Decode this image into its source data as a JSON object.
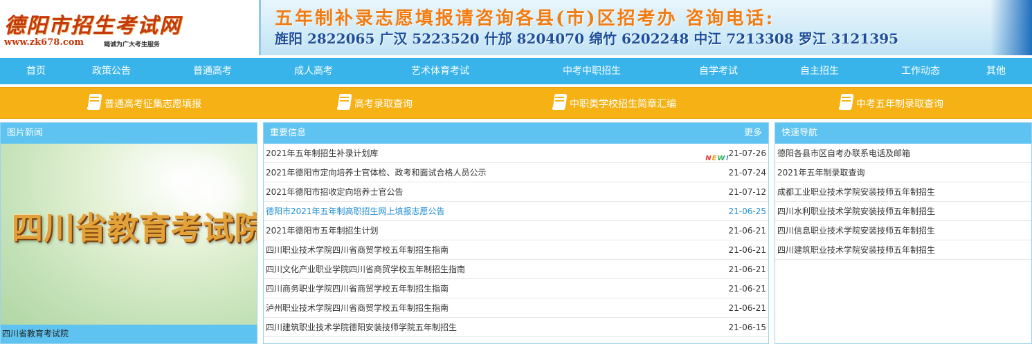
{
  "header": {
    "logo_text": "德阳市招生考试网",
    "logo_url": "www.zk678.com",
    "logo_slogan": "竭诚为广大考生服务",
    "banner_line1": "五年制补录志愿填报请咨询各县(市)区招考办 咨询电话:",
    "banner_line2": "旌阳 2822065  广汉 5223520  什邡 8204070  绵竹 6202248  中江 7213308  罗江 3121395"
  },
  "nav": {
    "items": [
      "首页",
      "政策公告",
      "普通高考",
      "成人高考",
      "艺术体育考试",
      "中考中职招生",
      "自学考试",
      "自主招生",
      "工作动态",
      "其他"
    ]
  },
  "quickbar": {
    "items": [
      "普通高考征集志愿填报",
      "高考录取查询",
      "中职类学校招生简章汇编",
      "中考五年制录取查询"
    ]
  },
  "photo_news": {
    "title": "图片新闻",
    "image_text": "四川省教育考试院",
    "caption": "四川省教育考试院"
  },
  "important": {
    "title": "重要信息",
    "more": "更多",
    "new_badge": "NEW!",
    "rows": [
      {
        "title": "2021年五年制招生补录计划库",
        "date": "21-07-26"
      },
      {
        "title": "2021年德阳市定向培养士官体检、政考和面试合格人员公示",
        "date": "21-07-24"
      },
      {
        "title": "2021年德阳市招收定向培养士官公告",
        "date": "21-07-12"
      },
      {
        "title": "德阳市2021年五年制高职招生网上填报志愿公告",
        "date": "21-06-25"
      },
      {
        "title": "2021年德阳市五年制招生计划",
        "date": "21-06-21"
      },
      {
        "title": "四川职业技术学院四川省商贸学校五年制招生指南",
        "date": "21-06-21"
      },
      {
        "title": "四川文化产业职业学院四川省商贸学校五年制招生指南",
        "date": "21-06-21"
      },
      {
        "title": "四川商务职业学院四川省商贸学校五年制招生指南",
        "date": "21-06-21"
      },
      {
        "title": "泸州职业技术学院四川省商贸学校五年制招生指南",
        "date": "21-06-21"
      },
      {
        "title": "四川建筑职业技术学院德阳安装技师学院五年制招生",
        "date": "21-06-15"
      }
    ]
  },
  "quick_nav": {
    "title": "快速导航",
    "items": [
      "德阳各县市区自考办联系电话及邮箱",
      "2021年五年制录取查询",
      "成都工业职业技术学院安装技师五年制招生",
      "四川水利职业技术学院安装技师五年制招生",
      "四川信息职业技术学院安装技师五年制招生",
      "四川建筑职业技术学院安装技师五年制招生"
    ]
  },
  "colors": {
    "nav_bg": "#39b4ea",
    "quickbar_bg": "#f6b214",
    "panel_head": "#5ec3f0",
    "highlight_link": "#1f8ed6",
    "logo_red": "#c23a0c"
  }
}
